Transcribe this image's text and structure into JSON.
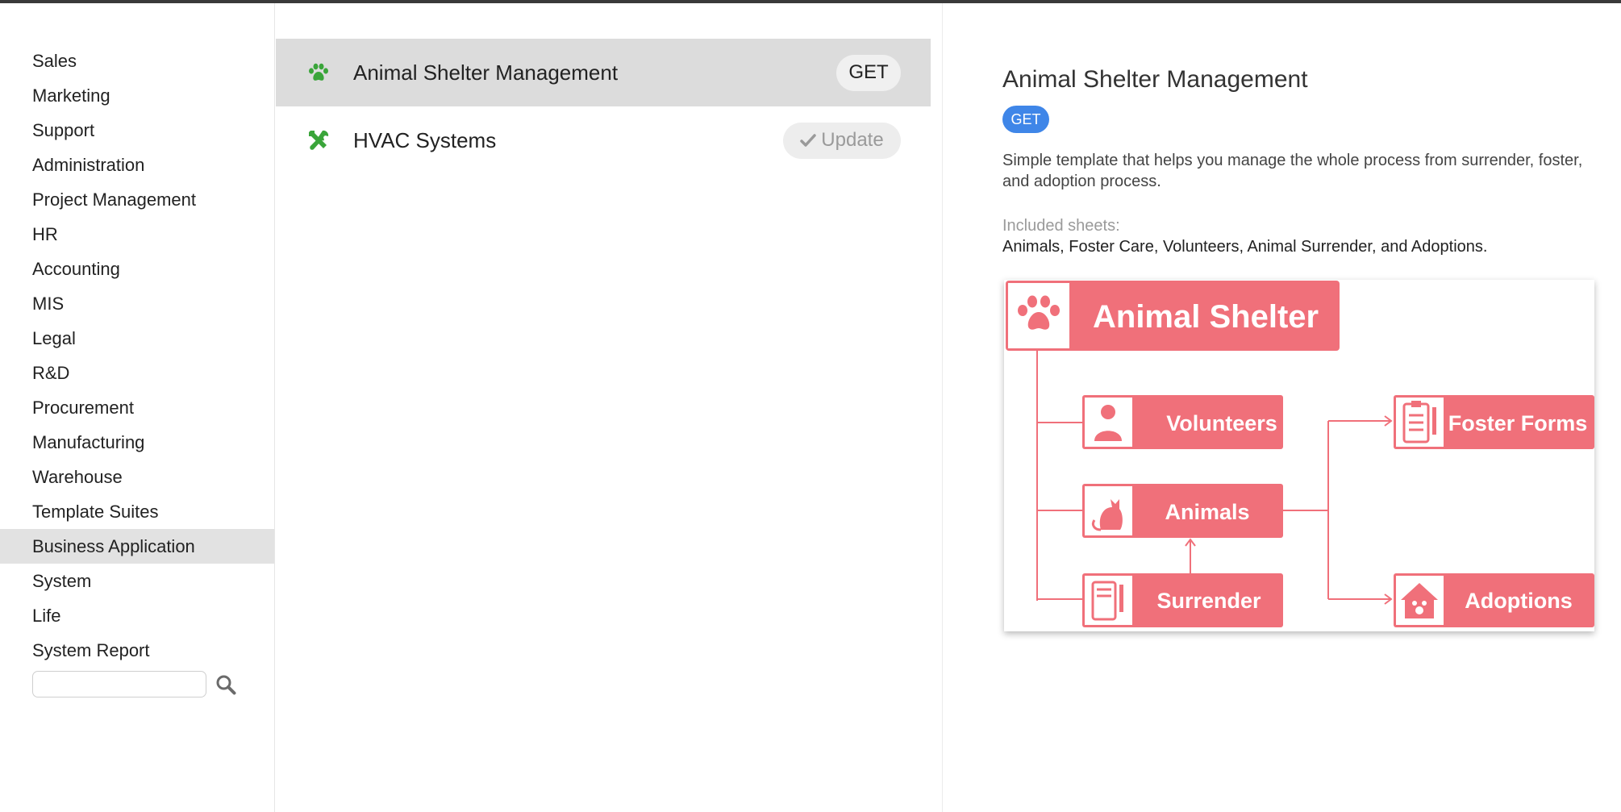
{
  "sidebar": {
    "categories": [
      {
        "label": "Sales"
      },
      {
        "label": "Marketing"
      },
      {
        "label": "Support"
      },
      {
        "label": "Administration"
      },
      {
        "label": "Project Management"
      },
      {
        "label": "HR"
      },
      {
        "label": "Accounting"
      },
      {
        "label": "MIS"
      },
      {
        "label": "Legal"
      },
      {
        "label": "R&D"
      },
      {
        "label": "Procurement"
      },
      {
        "label": "Manufacturing"
      },
      {
        "label": "Warehouse"
      },
      {
        "label": "Template Suites"
      },
      {
        "label": "Business Application",
        "active": true
      },
      {
        "label": "System"
      },
      {
        "label": "Life"
      },
      {
        "label": "System Report"
      }
    ],
    "search": {
      "value": "",
      "placeholder": ""
    }
  },
  "templates": [
    {
      "name": "Animal Shelter Management",
      "icon": "paw-icon",
      "action": "GET",
      "selected": true
    },
    {
      "name": "HVAC Systems",
      "icon": "tools-icon",
      "action": "Update",
      "installed": true
    }
  ],
  "detail": {
    "title": "Animal Shelter Management",
    "get_label": "GET",
    "description": "Simple template that helps you manage the whole process from surrender, foster, and adoption process.",
    "included_label": "Included sheets:",
    "included_value": "Animals, Foster Care, Volunteers, Animal Surrender, and Adoptions.",
    "preview": {
      "header": "Animal Shelter",
      "nodes": [
        "Volunteers",
        "Animals",
        "Surrender",
        "Foster Forms",
        "Adoptions"
      ]
    }
  },
  "colors": {
    "brand_pink": "#f0707a",
    "icon_green": "#3aa53a",
    "accent_blue": "#3f86e8",
    "selected_row": "#dcdcdc",
    "active_category": "#e2e2e2"
  }
}
